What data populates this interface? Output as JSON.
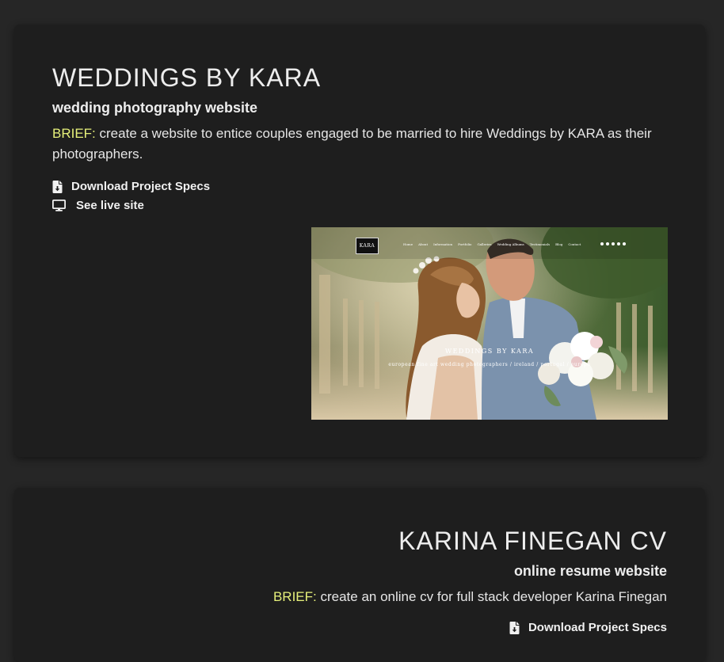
{
  "projects": [
    {
      "title": "WEDDINGS BY KARA",
      "subtitle": "wedding photography website",
      "brief_label": "BRIEF:",
      "brief_text": " create a website to entice couples engaged to be married to hire Weddings by KARA as their photographers.",
      "links": {
        "specs": "Download Project Specs",
        "live": "See live site"
      },
      "screenshot": {
        "logo_text": "KARA",
        "menu": [
          "Home",
          "About",
          "Information",
          "Portfolio",
          "Galleries",
          "Wedding Albums",
          "Testimonials",
          "Blog",
          "Contact"
        ],
        "heading": "WEDDINGS BY KARA",
        "tagline": "european fine art wedding photographers / ireland / portugal / europe"
      }
    },
    {
      "title": "KARINA FINEGAN CV",
      "subtitle": "online resume website",
      "brief_label": "BRIEF:",
      "brief_text": " create an online cv for full stack developer Karina Finegan",
      "links": {
        "specs": "Download Project Specs"
      }
    }
  ],
  "icons": {
    "specs": "file-download-icon",
    "live": "monitor-icon"
  },
  "colors": {
    "page_bg": "#262626",
    "card_bg": "#1e1e1e",
    "brief_accent": "#e6f07a",
    "text": "#ececec"
  }
}
